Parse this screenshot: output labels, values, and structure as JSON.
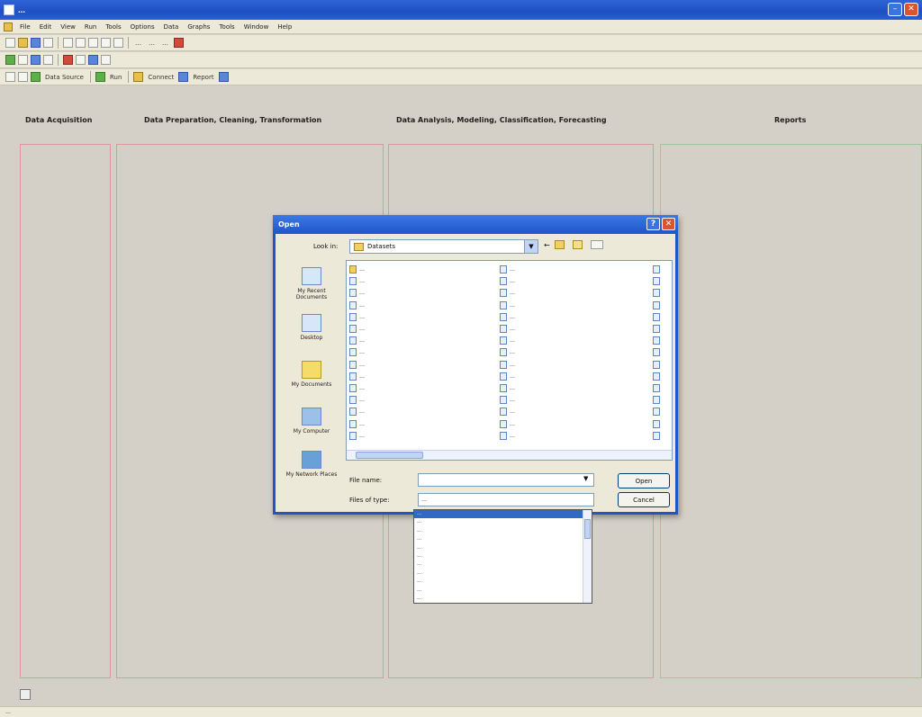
{
  "app": {
    "title": "…",
    "menu": [
      "File",
      "Edit",
      "View",
      "Run",
      "Tools",
      "Options",
      "Data",
      "Graphs",
      "Tools",
      "Window",
      "Help"
    ],
    "toolbar1": [
      "…",
      "…",
      "…"
    ],
    "toolbar3": {
      "data_source": "Data Source",
      "run": "Run",
      "connect": "Connect",
      "report": "Report"
    }
  },
  "sections": {
    "acquisition": "Data Acquisition",
    "preparation": "Data Preparation, Cleaning, Transformation",
    "analysis": "Data Analysis, Modeling, Classification, Forecasting",
    "reports": "Reports"
  },
  "dialog": {
    "title": "Open",
    "look_in_label": "Look in:",
    "look_in_value": "Datasets",
    "places": [
      "My Recent Documents",
      "Desktop",
      "My Documents",
      "My Computer",
      "My Network Places"
    ],
    "files_col1": [
      {
        "name": "…",
        "type": "folder"
      },
      {
        "name": "…",
        "type": "file"
      },
      {
        "name": "…",
        "type": "file"
      },
      {
        "name": "…",
        "type": "file"
      },
      {
        "name": "…",
        "type": "file"
      },
      {
        "name": "…",
        "type": "file"
      },
      {
        "name": "…",
        "type": "file"
      },
      {
        "name": "…",
        "type": "file"
      },
      {
        "name": "…",
        "type": "file"
      },
      {
        "name": "…",
        "type": "file"
      },
      {
        "name": "…",
        "type": "file"
      },
      {
        "name": "…",
        "type": "file"
      },
      {
        "name": "…",
        "type": "file"
      },
      {
        "name": "…",
        "type": "file"
      },
      {
        "name": "…",
        "type": "file"
      }
    ],
    "files_col2": [
      {
        "name": "…",
        "type": "file"
      },
      {
        "name": "…",
        "type": "file"
      },
      {
        "name": "…",
        "type": "file"
      },
      {
        "name": "…",
        "type": "file"
      },
      {
        "name": "…",
        "type": "file"
      },
      {
        "name": "…",
        "type": "file"
      },
      {
        "name": "…",
        "type": "file"
      },
      {
        "name": "…",
        "type": "file"
      },
      {
        "name": "…",
        "type": "file"
      },
      {
        "name": "…",
        "type": "file"
      },
      {
        "name": "…",
        "type": "file"
      },
      {
        "name": "…",
        "type": "file"
      },
      {
        "name": "…",
        "type": "file"
      },
      {
        "name": "…",
        "type": "file"
      },
      {
        "name": "…",
        "type": "file"
      }
    ],
    "file_name_label": "File name:",
    "file_name_value": "",
    "file_type_label": "Files of type:",
    "file_type_value": "…",
    "open_button": "Open",
    "cancel_button": "Cancel",
    "type_options": [
      "…",
      "…",
      "…",
      "…",
      "…",
      "…",
      "…",
      "…",
      "…",
      "…",
      "…"
    ],
    "type_selected_index": 0
  },
  "status": {
    "text": "…"
  }
}
